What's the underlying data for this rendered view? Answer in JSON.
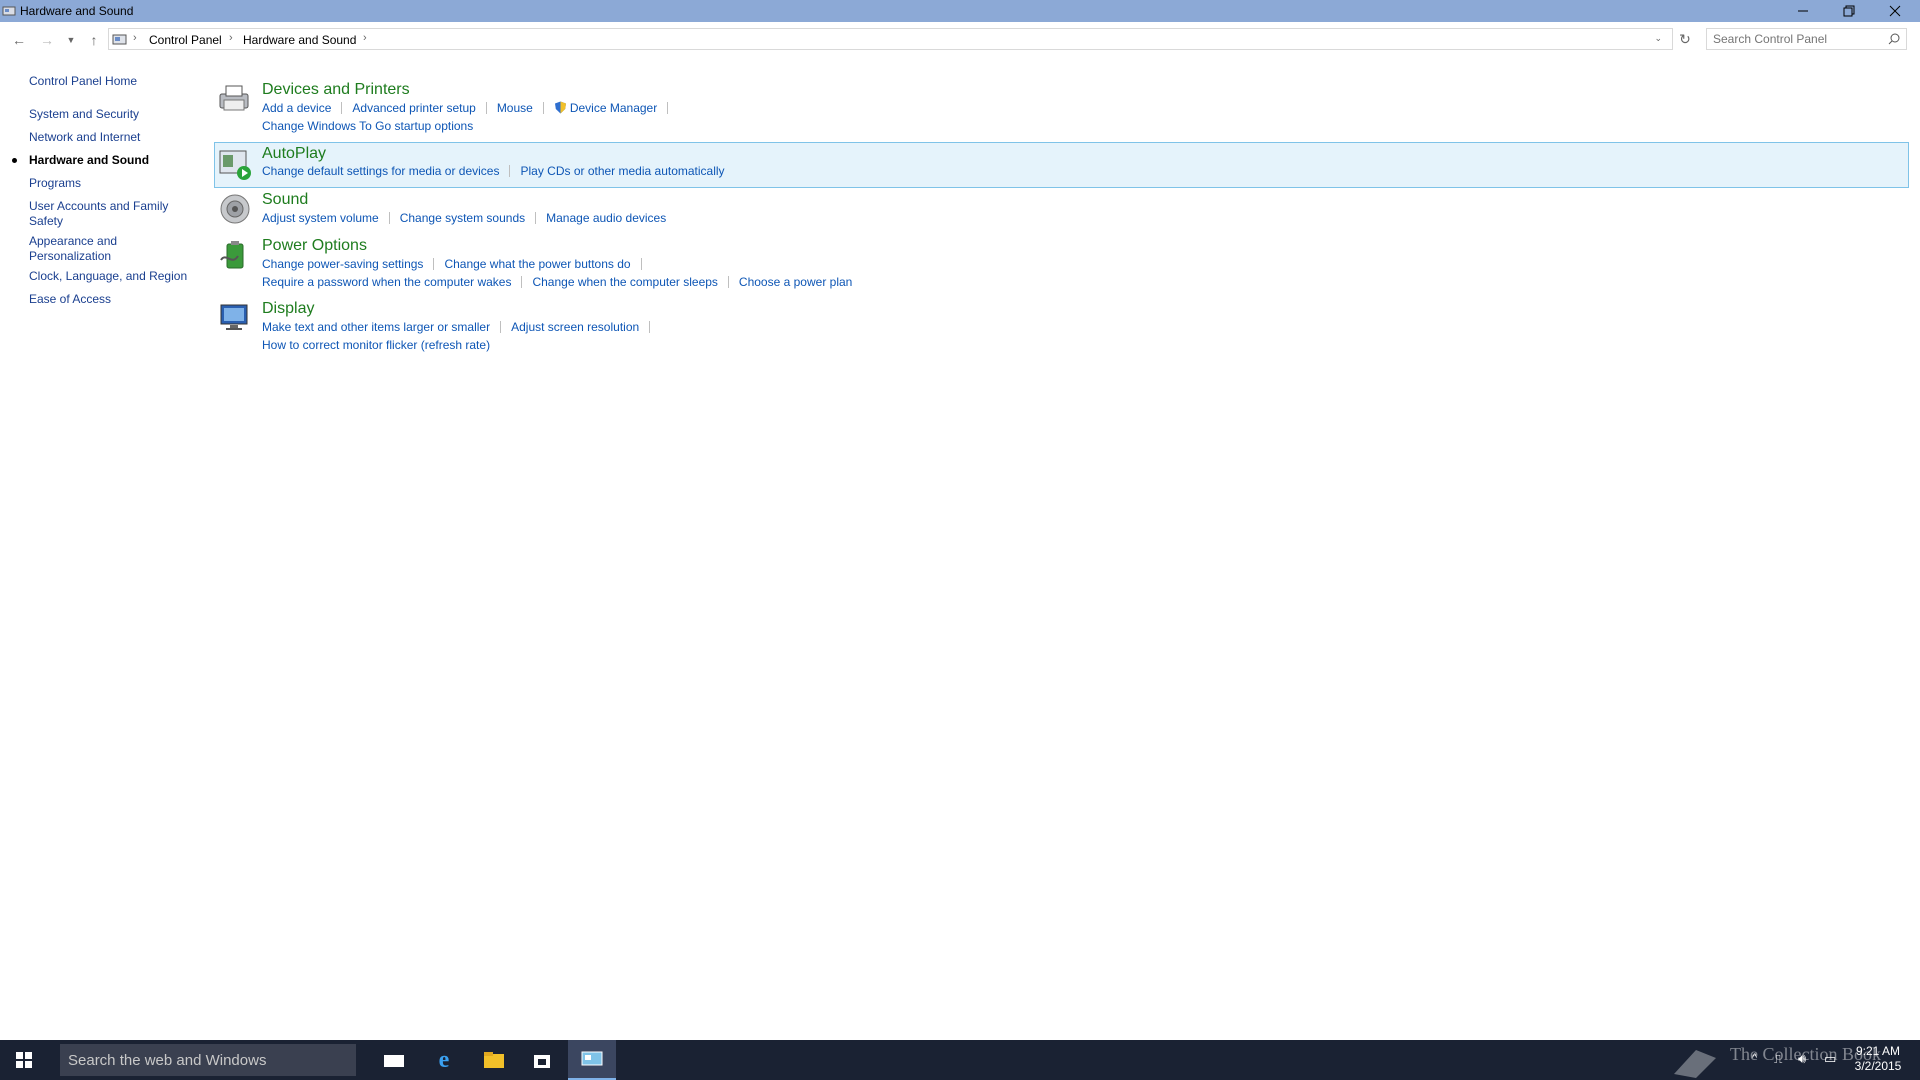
{
  "window": {
    "title": "Hardware and Sound",
    "controls": {
      "minimize": "minimize-icon",
      "restore": "restore-icon",
      "close": "close-icon"
    }
  },
  "navbar": {
    "breadcrumb": [
      "Control Panel",
      "Hardware and Sound"
    ],
    "search_placeholder": "Search Control Panel"
  },
  "sidebar": {
    "items": [
      {
        "label": "Control Panel Home"
      },
      {
        "label": "System and Security"
      },
      {
        "label": "Network and Internet"
      },
      {
        "label": "Hardware and Sound",
        "current": true
      },
      {
        "label": "Programs"
      },
      {
        "label": "User Accounts and Family Safety"
      },
      {
        "label": "Appearance and Personalization"
      },
      {
        "label": "Clock, Language, and Region"
      },
      {
        "label": "Ease of Access"
      }
    ]
  },
  "categories": [
    {
      "title": "Devices and Printers",
      "icon": "printer-icon",
      "rows": [
        [
          "Add a device",
          "Advanced printer setup",
          "Mouse",
          "Device Manager"
        ],
        [
          "Change Windows To Go startup options"
        ]
      ]
    },
    {
      "title": "AutoPlay",
      "icon": "autoplay-icon",
      "highlighted": true,
      "rows": [
        [
          "Change default settings for media or devices",
          "Play CDs or other media automatically"
        ]
      ]
    },
    {
      "title": "Sound",
      "icon": "speaker-icon",
      "rows": [
        [
          "Adjust system volume",
          "Change system sounds",
          "Manage audio devices"
        ]
      ]
    },
    {
      "title": "Power Options",
      "icon": "battery-icon",
      "rows": [
        [
          "Change power-saving settings",
          "Change what the power buttons do"
        ],
        [
          "Require a password when the computer wakes",
          "Change when the computer sleeps",
          "Choose a power plan"
        ]
      ]
    },
    {
      "title": "Display",
      "icon": "monitor-icon",
      "rows": [
        [
          "Make text and other items larger or smaller",
          "Adjust screen resolution"
        ],
        [
          "How to correct monitor flicker (refresh rate)"
        ]
      ]
    }
  ],
  "taskbar": {
    "search_placeholder": "Search the web and Windows",
    "watermark": "The Collection Book",
    "time": "9:21 AM",
    "date": "3/2/2015"
  },
  "colors": {
    "titlebar": "#8ca9d6",
    "link": "#0e56b5",
    "category_title": "#1e7c1e",
    "highlight_bg": "#e5f3fb",
    "highlight_border": "#7fc3e8",
    "taskbar": "#1a2233"
  }
}
